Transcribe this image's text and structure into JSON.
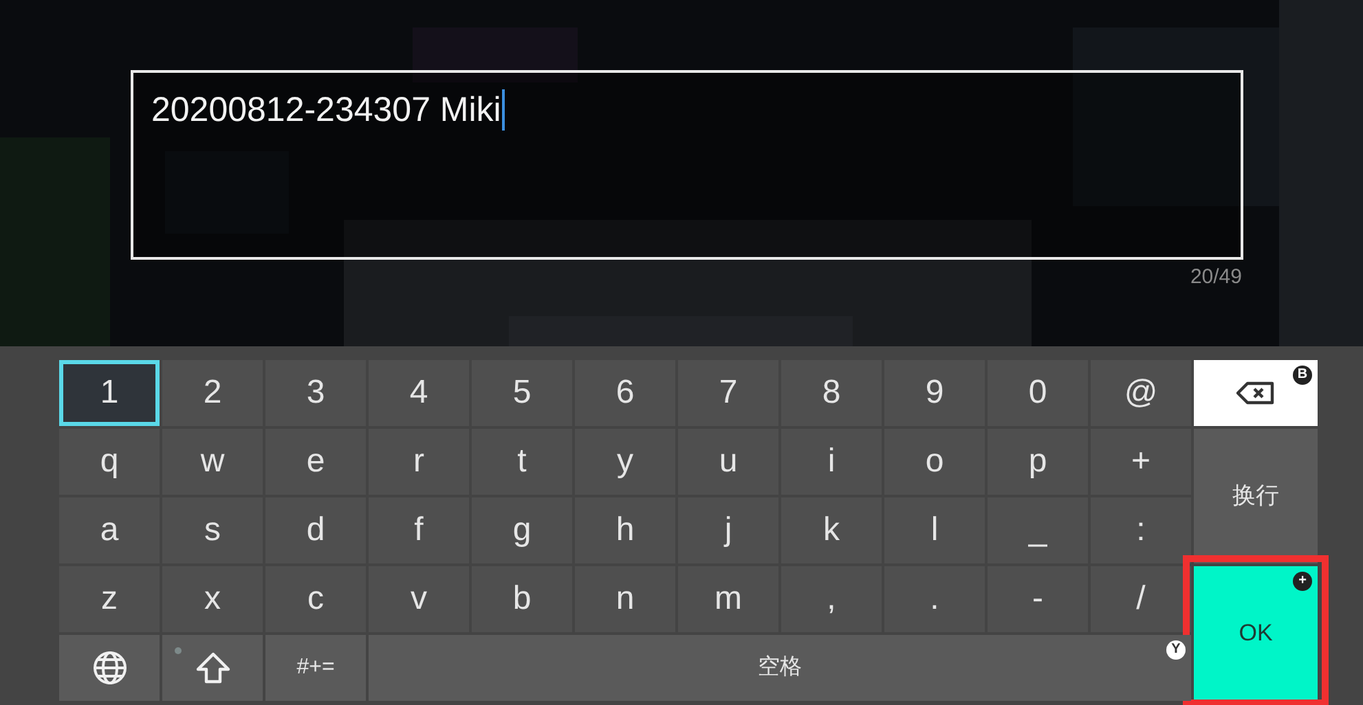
{
  "text_field": {
    "value": "20200812-234307 Miki",
    "counter": "20/49"
  },
  "keyboard": {
    "rows": [
      [
        {
          "label": "1",
          "selected": true
        },
        {
          "label": "2",
          "selected": false
        },
        {
          "label": "3",
          "selected": false
        },
        {
          "label": "4",
          "selected": false
        },
        {
          "label": "5",
          "selected": false
        },
        {
          "label": "6",
          "selected": false
        },
        {
          "label": "7",
          "selected": false
        },
        {
          "label": "8",
          "selected": false
        },
        {
          "label": "9",
          "selected": false
        },
        {
          "label": "0",
          "selected": false
        },
        {
          "label": "@",
          "selected": false
        }
      ],
      [
        {
          "label": "q",
          "selected": false
        },
        {
          "label": "w",
          "selected": false
        },
        {
          "label": "e",
          "selected": false
        },
        {
          "label": "r",
          "selected": false
        },
        {
          "label": "t",
          "selected": false
        },
        {
          "label": "y",
          "selected": false
        },
        {
          "label": "u",
          "selected": false
        },
        {
          "label": "i",
          "selected": false
        },
        {
          "label": "o",
          "selected": false
        },
        {
          "label": "p",
          "selected": false
        },
        {
          "label": "+",
          "selected": false
        }
      ],
      [
        {
          "label": "a",
          "selected": false
        },
        {
          "label": "s",
          "selected": false
        },
        {
          "label": "d",
          "selected": false
        },
        {
          "label": "f",
          "selected": false
        },
        {
          "label": "g",
          "selected": false
        },
        {
          "label": "h",
          "selected": false
        },
        {
          "label": "j",
          "selected": false
        },
        {
          "label": "k",
          "selected": false
        },
        {
          "label": "l",
          "selected": false
        },
        {
          "label": "_",
          "selected": false
        },
        {
          "label": ":",
          "selected": false
        }
      ],
      [
        {
          "label": "z",
          "selected": false
        },
        {
          "label": "x",
          "selected": false
        },
        {
          "label": "c",
          "selected": false
        },
        {
          "label": "v",
          "selected": false
        },
        {
          "label": "b",
          "selected": false
        },
        {
          "label": "n",
          "selected": false
        },
        {
          "label": "m",
          "selected": false
        },
        {
          "label": ",",
          "selected": false
        },
        {
          "label": ".",
          "selected": false
        },
        {
          "label": "-",
          "selected": false
        },
        {
          "label": "/",
          "selected": false
        }
      ]
    ],
    "backspace": {
      "badge": "B"
    },
    "enter": {
      "label": "换行"
    },
    "symbols": {
      "label": "#+="
    },
    "space": {
      "label": "空格",
      "badge": "Y"
    },
    "ok": {
      "label": "OK",
      "badge": "+",
      "highlighted": true
    }
  }
}
